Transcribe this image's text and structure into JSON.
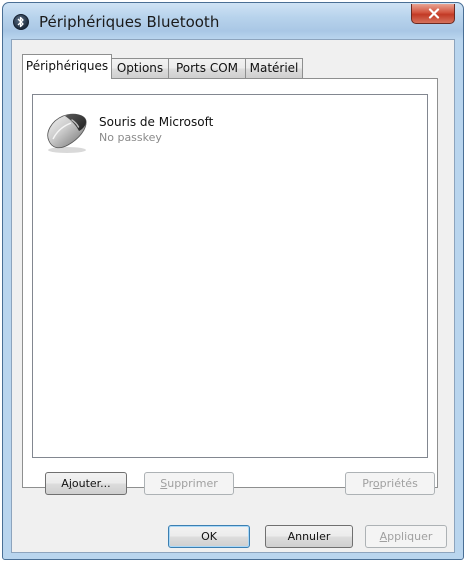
{
  "window": {
    "title": "Périphériques Bluetooth",
    "title_icon": "bluetooth-icon",
    "close_icon": "close-icon"
  },
  "tabs": [
    {
      "label": "Périphériques",
      "active": true
    },
    {
      "label": "Options",
      "active": false
    },
    {
      "label": "Ports COM",
      "active": false
    },
    {
      "label": "Matériel",
      "active": false
    }
  ],
  "devices": [
    {
      "name": "Souris de Microsoft",
      "status": "No passkey",
      "icon": "mouse-icon"
    }
  ],
  "panel_buttons": {
    "add_pre": "A",
    "add_ul": "j",
    "add_post": "outer...",
    "remove_ul": "S",
    "remove_post": "upprimer",
    "props_pre": "Pr",
    "props_ul": "o",
    "props_post": "priétés"
  },
  "dialog_buttons": {
    "ok": "OK",
    "cancel": "Annuler",
    "apply_ul": "A",
    "apply_post": "ppliquer"
  },
  "colors": {
    "title_bar": "#b8d3ec",
    "close_button": "#c23a26",
    "face": "#f0f0f0",
    "default_border": "#3c7fb1"
  }
}
